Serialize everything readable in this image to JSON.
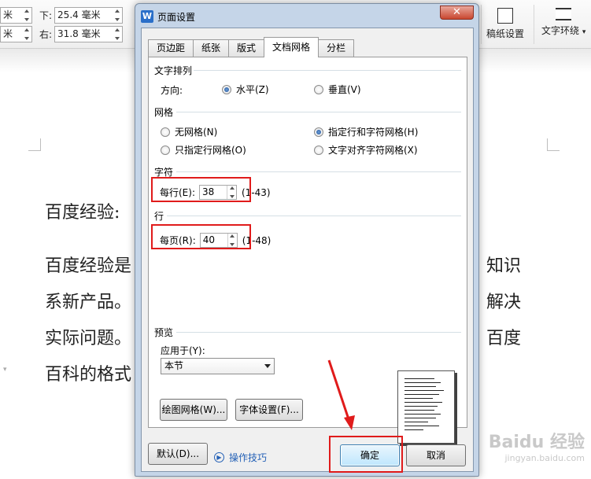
{
  "ribbon": {
    "left_unit_top": "米",
    "left_unit_bottom": "米",
    "bottom_label": "下:",
    "bottom_value": "25.4 毫米",
    "right_label": "右:",
    "right_value": "31.8 毫米",
    "draft_button": "稿纸设置",
    "wrap_button": "文字环绕"
  },
  "document": {
    "heading": "百度经验:",
    "lines": [
      "百度经验是",
      "系新产品。",
      "实际问题。",
      "百科的格式"
    ],
    "right_lines": [
      "知识",
      "解决",
      "百度"
    ],
    "watermark": "Baidu 经验",
    "watermark_sub": "jingyan.baidu.com"
  },
  "dialog": {
    "title": "页面设置",
    "close": "✕",
    "tabs": [
      "页边距",
      "纸张",
      "版式",
      "文档网格",
      "分栏"
    ],
    "active_tab": 3,
    "text_direction": {
      "group_label": "文字排列",
      "direction_label": "方向:",
      "horizontal": "水平(Z)",
      "vertical": "垂直(V)"
    },
    "grid": {
      "group_label": "网格",
      "none": "无网格(N)",
      "line_char": "指定行和字符网格(H)",
      "line_only": "只指定行网格(O)",
      "snap_char": "文字对齐字符网格(X)"
    },
    "chars": {
      "group_label": "字符",
      "per_line_label": "每行(E):",
      "per_line_value": "38",
      "range": "(1-43)"
    },
    "lines": {
      "group_label": "行",
      "per_page_label": "每页(R):",
      "per_page_value": "40",
      "range": "(1-48)"
    },
    "preview": {
      "group_label": "预览",
      "apply_label": "应用于(Y):",
      "apply_value": "本节"
    },
    "draw_grid_button": "绘图网格(W)...",
    "font_settings_button": "字体设置(F)...",
    "default_button": "默认(D)...",
    "tips_link": "操作技巧",
    "ok_button": "确定",
    "cancel_button": "取消"
  },
  "colors": {
    "annotation_red": "#e01b1b",
    "dialog_frame": "#c5d5e8",
    "link_blue": "#2461b6"
  }
}
